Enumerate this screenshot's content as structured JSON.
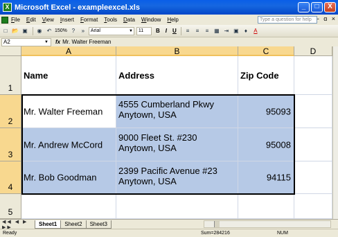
{
  "window": {
    "title": "Microsoft Excel - exampleexcel.xls",
    "icon": "X",
    "controls": [
      "_",
      "□",
      "X"
    ]
  },
  "menu": {
    "items": [
      "File",
      "Edit",
      "View",
      "Insert",
      "Format",
      "Tools",
      "Data",
      "Window",
      "Help"
    ],
    "help_placeholder": "Type a question for help",
    "doc_controls": "- ɑ ×"
  },
  "toolbar": {
    "zoom": "150%",
    "font": "Arial",
    "size": "11",
    "bold": "B",
    "italic": "I",
    "underline": "U"
  },
  "formula_bar": {
    "name_box": "A2",
    "fx": "fx",
    "content": "Mr. Walter Freeman"
  },
  "columns": [
    "A",
    "B",
    "C",
    "D"
  ],
  "rows": [
    "1",
    "2",
    "3",
    "4",
    "5"
  ],
  "headers": {
    "name": "Name",
    "address": "Address",
    "zip": "Zip Code"
  },
  "records": [
    {
      "name": "Mr. Walter Freeman",
      "address1": "4555 Cumberland Pkwy",
      "address2": "Anytown, USA",
      "zip": "95093"
    },
    {
      "name": "Mr. Andrew McCord",
      "address1": "9000 Fleet St. #230",
      "address2": "Anytown, USA",
      "zip": "95008"
    },
    {
      "name": "Mr. Bob Goodman",
      "address1": "2399 Pacific Avenue #23",
      "address2": "Anytown, USA",
      "zip": "94115"
    }
  ],
  "sheets": [
    "Sheet1",
    "Sheet2",
    "Sheet3"
  ],
  "active_sheet": "Sheet1",
  "status": {
    "ready": "Ready",
    "sum": "Sum=284216",
    "num": "NUM"
  },
  "colors": {
    "selection": "#b6c9e6",
    "title_bar": "#0a5ee8",
    "header_highlight": "#f8d88f"
  }
}
